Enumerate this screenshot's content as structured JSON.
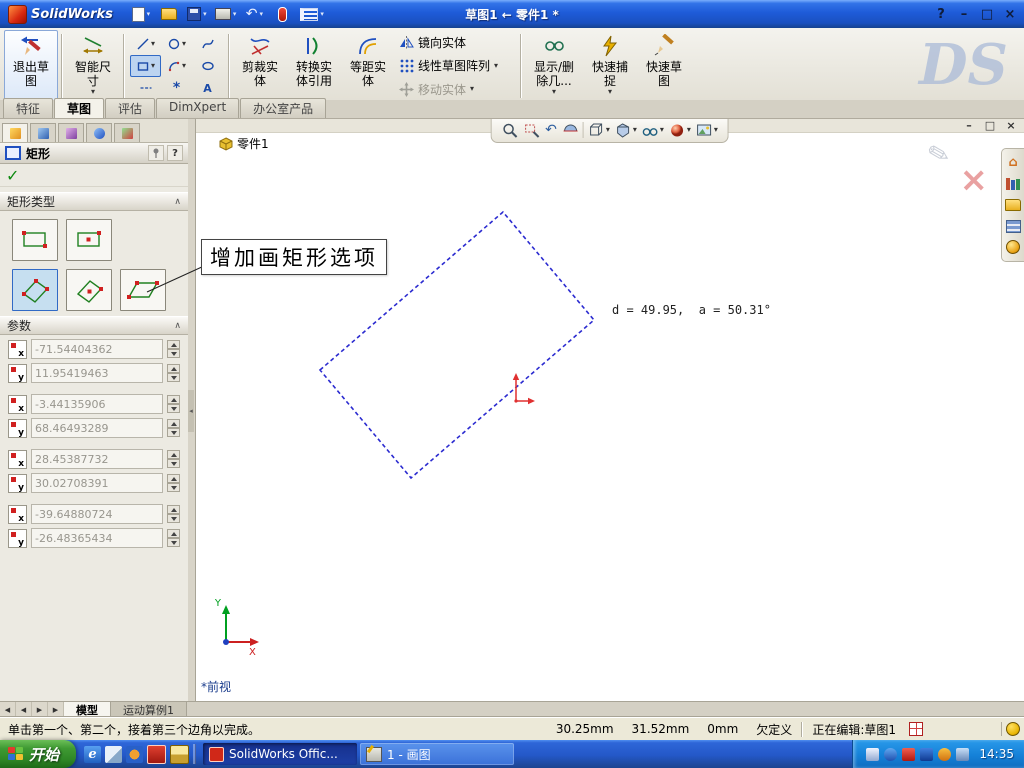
{
  "colors": {
    "sketch_preview_blue": "#2b2bd0",
    "origin_red": "#e03030",
    "axis_x_red": "#cc2020",
    "axis_y_green": "#00a020",
    "selection_blue": "#316ac5"
  },
  "titlebar": {
    "app_name": "SolidWorks",
    "doc_title": "草图1 ← 零件1 *"
  },
  "command_tabs": [
    {
      "label": "特征"
    },
    {
      "label": "草图"
    },
    {
      "label": "评估"
    },
    {
      "label": "DimXpert"
    },
    {
      "label": "办公室产品"
    }
  ],
  "command_bar": {
    "exit_sketch": "退出草图",
    "smart_dimension": "智能尺寸",
    "trim": "剪裁实体",
    "convert": "转换实体引用",
    "offset": "等距实体",
    "mirror": "镜向实体",
    "linear_pattern": "线性草图阵列",
    "move": "移动实体",
    "display_delete": "显示/删除几...",
    "quick_snaps": "快速捕捉",
    "rapid_sketch": "快速草图"
  },
  "property_panel": {
    "title": "矩形",
    "rect_type_label": "矩形类型",
    "params_label": "参数",
    "params": [
      {
        "axis": "x",
        "value": "-71.54404362"
      },
      {
        "axis": "y",
        "value": "11.95419463"
      },
      {
        "axis": "x",
        "value": "-3.44135906"
      },
      {
        "axis": "y",
        "value": "68.46493289"
      },
      {
        "axis": "x",
        "value": "28.45387732"
      },
      {
        "axis": "y",
        "value": "30.02708391"
      },
      {
        "axis": "x",
        "value": "-39.64880724"
      },
      {
        "axis": "y",
        "value": "-26.48365434"
      }
    ]
  },
  "graphics": {
    "part_label": "零件1",
    "dimension_readout": "d = 49.95,  a = 50.31°",
    "callout_text": "增加画矩形选项",
    "view_label": "*前视",
    "axis_x": "X",
    "axis_y": "Y",
    "watermark": "DS"
  },
  "bottom_tabs": [
    {
      "label": "模型"
    },
    {
      "label": "运动算例1"
    }
  ],
  "status_bar": {
    "hint": "单击第一个、第二个，接着第三个边角以完成。",
    "coord_x": "30.25mm",
    "coord_y": "31.52mm",
    "coord_z": "0mm",
    "definition_state": "欠定义",
    "editing_state": "正在编辑:草图1"
  },
  "taskbar": {
    "start_label": "开始",
    "tasks": [
      {
        "label": "SolidWorks Offic..."
      },
      {
        "label": "1 - 画图"
      }
    ],
    "clock": "14:35"
  },
  "icons": {
    "caret_down": "▾",
    "help": "?",
    "minimize": "–",
    "maximize": "□",
    "close": "×",
    "ok_check": "✓",
    "section_collapse": "∧",
    "panel_collapse": "◂",
    "nav_first": "◀",
    "nav_prev": "◀",
    "nav_next": "▶",
    "nav_last": "▶",
    "undo": "↶",
    "text_tool": "A",
    "point_tool": "*",
    "home": "⌂",
    "pencil": "✎",
    "ie": "e"
  }
}
